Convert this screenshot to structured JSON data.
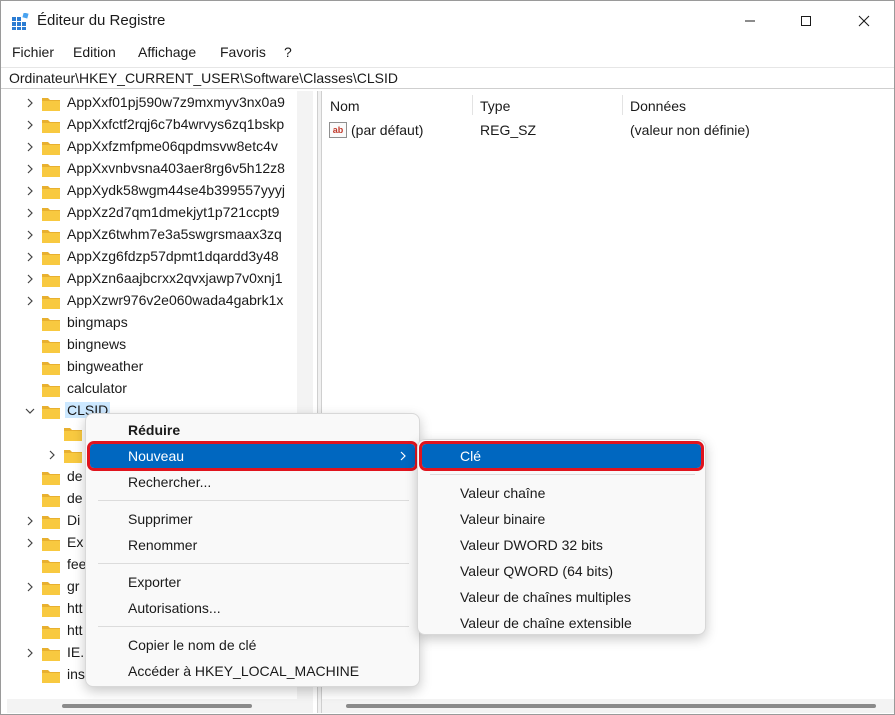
{
  "window": {
    "title": "Éditeur du Registre"
  },
  "menubar": [
    "Fichier",
    "Edition",
    "Affichage",
    "Favoris",
    "?"
  ],
  "address": "Ordinateur\\HKEY_CURRENT_USER\\Software\\Classes\\CLSID",
  "tree": [
    {
      "label": "AppXxf01pj590w7z9mxmyv3nx0a9",
      "expandable": true
    },
    {
      "label": "AppXxfctf2rqj6c7b4wrvys6zq1bskp",
      "expandable": true
    },
    {
      "label": "AppXxfzmfpme06qpdmsvw8etc4v",
      "expandable": true
    },
    {
      "label": "AppXxvnbvsna403aer8rg6v5h12z8",
      "expandable": true
    },
    {
      "label": "AppXydk58wgm44se4b399557yyyj",
      "expandable": true
    },
    {
      "label": "AppXz2d7qm1dmekjyt1p721ccpt9",
      "expandable": true
    },
    {
      "label": "AppXz6twhm7e3a5swgrsmaax3zq",
      "expandable": true
    },
    {
      "label": "AppXzg6fdzp57dpmt1dqardd3y48",
      "expandable": true
    },
    {
      "label": "AppXzn6aajbcrxx2qvxjawp7v0xnj1",
      "expandable": true
    },
    {
      "label": "AppXzwr976v2e060wada4gabrk1x",
      "expandable": true
    },
    {
      "label": "bingmaps",
      "expandable": false
    },
    {
      "label": "bingnews",
      "expandable": false
    },
    {
      "label": "bingweather",
      "expandable": false
    },
    {
      "label": "calculator",
      "expandable": false
    },
    {
      "label": "CLSID",
      "expandable": true,
      "expanded": true,
      "selected": true
    },
    {
      "label": "",
      "expandable": false,
      "indent": 1
    },
    {
      "label": "",
      "expandable": true,
      "indent": 1
    },
    {
      "label": "de",
      "expandable": false
    },
    {
      "label": "de",
      "expandable": false
    },
    {
      "label": "Di",
      "expandable": true
    },
    {
      "label": "Ex",
      "expandable": true
    },
    {
      "label": "fee",
      "expandable": false
    },
    {
      "label": "gr",
      "expandable": true
    },
    {
      "label": "htt",
      "expandable": false
    },
    {
      "label": "htt",
      "expandable": false
    },
    {
      "label": "IE.",
      "expandable": true
    },
    {
      "label": "ins",
      "expandable": false
    }
  ],
  "list": {
    "columns": [
      "Nom",
      "Type",
      "Données"
    ],
    "rows": [
      {
        "icon": "ab",
        "name": "(par défaut)",
        "type": "REG_SZ",
        "data": "(valeur non définie)"
      }
    ]
  },
  "context_menu": {
    "items": [
      {
        "label": "Réduire",
        "bold": true
      },
      {
        "label": "Nouveau",
        "submenu": true,
        "highlighted": true
      },
      {
        "label": "Rechercher..."
      },
      {
        "label": "Supprimer"
      },
      {
        "label": "Renommer"
      },
      {
        "label": "Exporter"
      },
      {
        "label": "Autorisations..."
      },
      {
        "label": "Copier le nom de clé"
      },
      {
        "label": "Accéder à HKEY_LOCAL_MACHINE"
      }
    ]
  },
  "submenu": {
    "items": [
      {
        "label": "Clé",
        "highlighted": true
      },
      {
        "label": "Valeur chaîne"
      },
      {
        "label": "Valeur binaire"
      },
      {
        "label": "Valeur DWORD 32 bits"
      },
      {
        "label": "Valeur QWORD (64 bits)"
      },
      {
        "label": "Valeur de chaînes multiples"
      },
      {
        "label": "Valeur de chaîne extensible"
      }
    ]
  },
  "colors": {
    "highlight": "#0067c0",
    "highlight_border": "#e0141e",
    "folder": "#f8c940",
    "selection": "#cce8ff"
  }
}
